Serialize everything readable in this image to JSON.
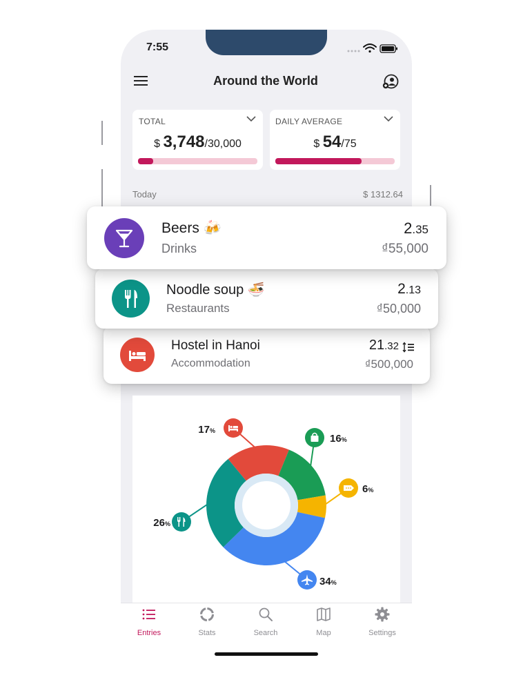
{
  "status": {
    "time": "7:55"
  },
  "header": {
    "title": "Around the World"
  },
  "summary": [
    {
      "label": "TOTAL",
      "currency": "$",
      "spent": "3,748",
      "budget": "/30,000",
      "progress": 0.125
    },
    {
      "label": "DAILY AVERAGE",
      "currency": "$",
      "spent": "54",
      "budget": "/75",
      "progress": 0.72
    }
  ],
  "section": {
    "day": "Today",
    "total": "$ 1312.64"
  },
  "entries": [
    {
      "name": "Beers 🍻",
      "category": "Drinks",
      "amount_whole": "2",
      "amount_frac": ".35",
      "local_amount": "₫55,000",
      "color": "#6a3fb8",
      "icon": "cocktail-icon"
    },
    {
      "name": "Noodle soup 🍜",
      "category": "Restaurants",
      "amount_whole": "2",
      "amount_frac": ".13",
      "local_amount": "₫50,000",
      "color": "#0c9488",
      "icon": "fork-knife-icon"
    },
    {
      "name": "Hostel in Hanoi",
      "category": "Accommodation",
      "amount_whole": "21",
      "amount_frac": ".32",
      "local_amount": "₫500,000",
      "color": "#e24a3b",
      "icon": "bed-icon",
      "extra_icon": "split-list-icon"
    }
  ],
  "chart_data": {
    "type": "pie",
    "labels": [
      "Accommodation",
      "Shopping",
      "Other",
      "Transport",
      "Restaurants"
    ],
    "values": [
      17,
      16,
      6,
      34,
      26
    ],
    "display": [
      "17",
      "16",
      "6",
      "34",
      "26"
    ],
    "unit": "%",
    "colors": [
      "#e24a3b",
      "#1a9c55",
      "#f5b400",
      "#4486f0",
      "#0c9488"
    ],
    "icons": [
      "bed-icon",
      "shopping-bag-icon",
      "tag-icon",
      "airplane-icon",
      "fork-knife-icon"
    ]
  },
  "tabs": [
    {
      "label": "Entries",
      "icon": "list-icon",
      "active": true
    },
    {
      "label": "Stats",
      "icon": "ring-chart-icon",
      "active": false
    },
    {
      "label": "Search",
      "icon": "search-icon",
      "active": false
    },
    {
      "label": "Map",
      "icon": "map-icon",
      "active": false
    },
    {
      "label": "Settings",
      "icon": "gear-icon",
      "active": false
    }
  ]
}
